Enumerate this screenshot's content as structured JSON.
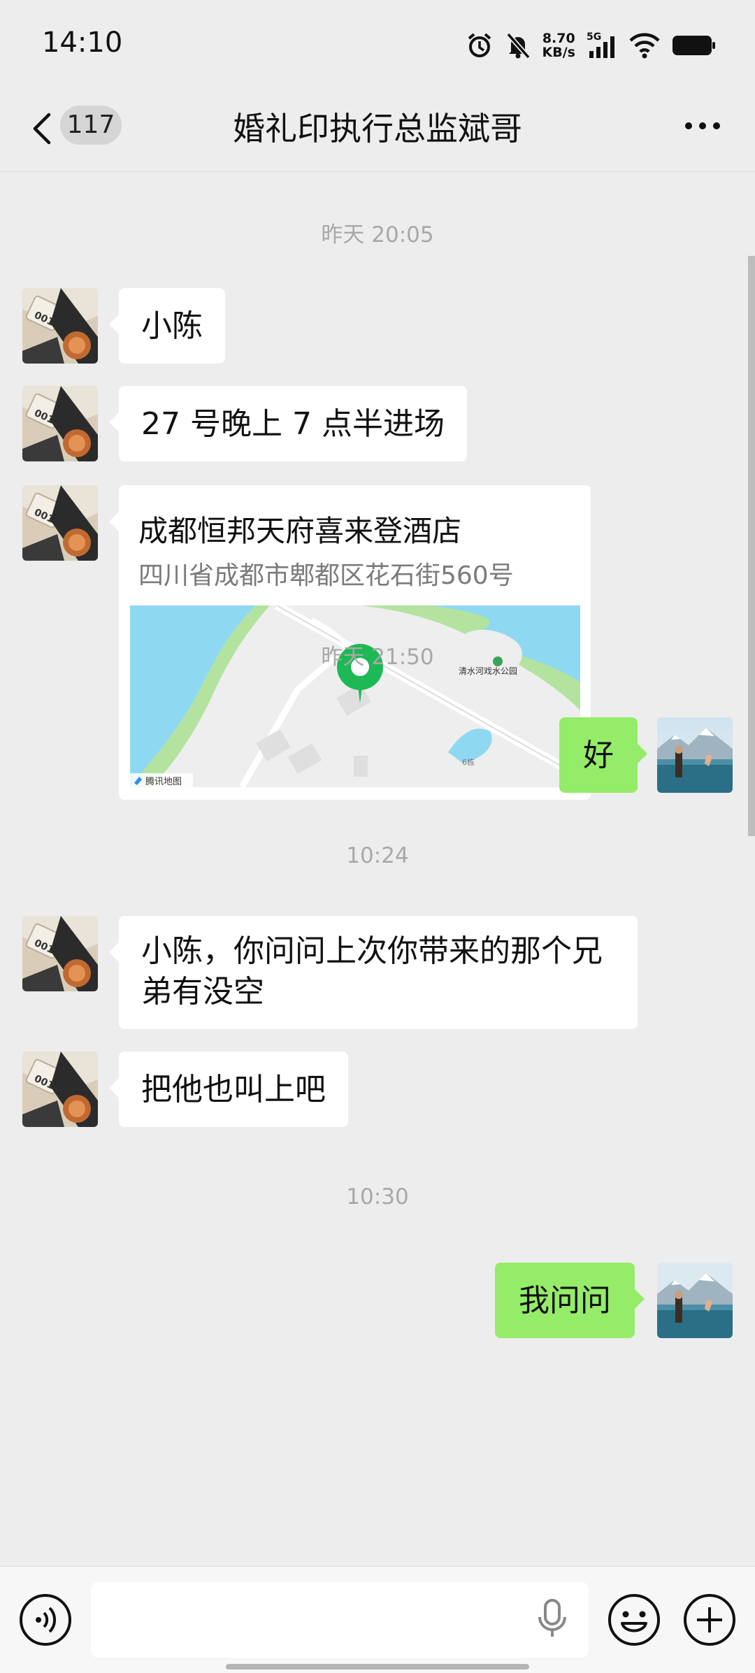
{
  "status_bar": {
    "time": "14:10",
    "net_speed_value": "8.70",
    "net_speed_unit": "KB/s",
    "network_type": "5G",
    "icons": [
      "alarm-icon",
      "mute-bell-icon",
      "signal-icon",
      "wifi-icon",
      "battery-icon"
    ]
  },
  "header": {
    "unread_count": "117",
    "title": "婚礼印执行总监斌哥",
    "icons": [
      "back-chevron-icon",
      "more-dots-icon"
    ]
  },
  "messages": {
    "ts1": "昨天 20:05",
    "m1": "小陈",
    "m2": "27 号晚上 7 点半进场",
    "location": {
      "name": "成都恒邦天府喜来登酒店",
      "address": "四川省成都市郫都区花石街560号",
      "map_attribution": "腾讯地图",
      "map_poi_park": "清水河戏水公园",
      "map_label_building": "6栋"
    },
    "ts2": "昨天 21:50",
    "m3": "好",
    "ts3": "10:24",
    "m4": "小陈，你问问上次你带来的那个兄弟有没空",
    "m5": "把他也叫上吧",
    "ts4": "10:30",
    "m6": "我问问"
  },
  "input_bar": {
    "icons": [
      "voice-icon",
      "microphone-icon",
      "emoji-icon",
      "plus-icon"
    ]
  },
  "colors": {
    "background": "#ededed",
    "outgoing_bubble": "#95ec69",
    "incoming_bubble": "#ffffff",
    "map_pin": "#1db954",
    "map_water": "#8fd8f2",
    "map_park": "#b4e3a0"
  }
}
